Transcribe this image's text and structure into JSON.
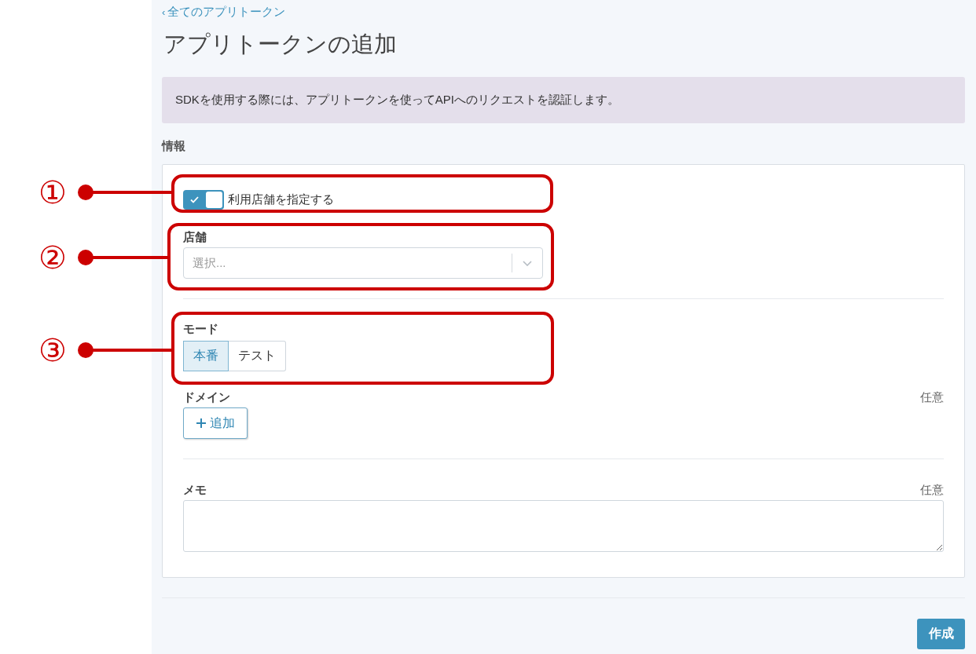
{
  "back_link": {
    "chevron": "‹",
    "label": "全てのアプリトークン"
  },
  "title": "アプリトークンの追加",
  "notice": "SDKを使用する際には、アプリトークンを使ってAPIへのリクエストを認証します。",
  "section_title": "情報",
  "store_toggle": {
    "label": "利用店舗を指定する",
    "on": true
  },
  "store_field": {
    "label": "店舗",
    "placeholder": "選択..."
  },
  "mode": {
    "label": "モード",
    "options": [
      {
        "label": "本番",
        "selected": true
      },
      {
        "label": "テスト",
        "selected": false
      }
    ]
  },
  "domain": {
    "label": "ドメイン",
    "optional": "任意",
    "add_button": "追加"
  },
  "memo": {
    "label": "メモ",
    "optional": "任意"
  },
  "submit_button": "作成",
  "annotations": [
    {
      "label": "①"
    },
    {
      "label": "②"
    },
    {
      "label": "③"
    }
  ]
}
